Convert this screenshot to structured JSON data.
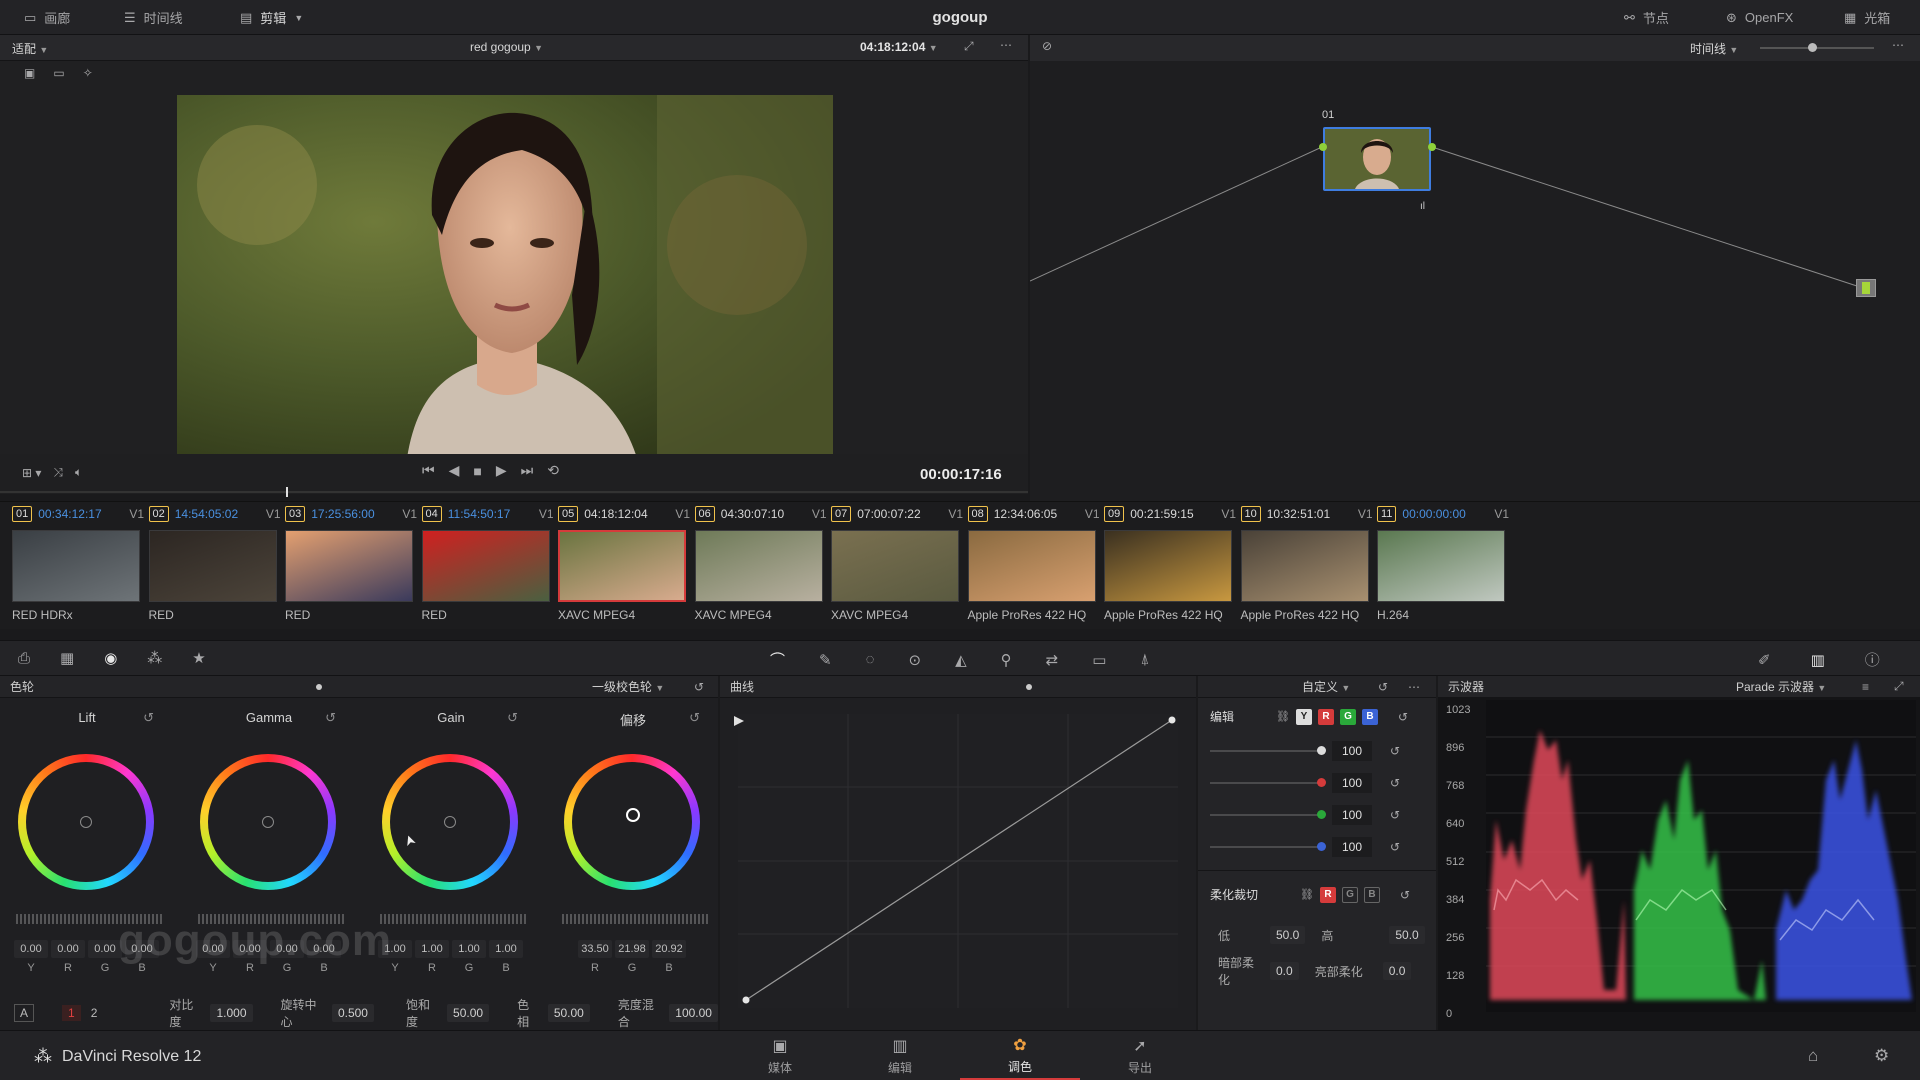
{
  "topbar": {
    "tabs": [
      {
        "label": "画廊"
      },
      {
        "label": "时间线"
      },
      {
        "label": "剪辑"
      }
    ],
    "title": "gogoup",
    "right": [
      {
        "label": "节点"
      },
      {
        "label": "OpenFX"
      },
      {
        "label": "光箱"
      }
    ]
  },
  "viewer": {
    "fit_label": "适配",
    "clip_name": "red gogoup",
    "timecode_top": "04:18:12:04",
    "timecode": "00:00:17:16"
  },
  "nodes": {
    "timeline_label": "时间线",
    "node_label": "01"
  },
  "clips": [
    {
      "num": "01",
      "tc": "00:34:12:17",
      "tc_blue": true,
      "track": "V1",
      "codec": "RED HDRx"
    },
    {
      "num": "02",
      "tc": "14:54:05:02",
      "tc_blue": true,
      "track": "V1",
      "codec": "RED"
    },
    {
      "num": "03",
      "tc": "17:25:56:00",
      "tc_blue": true,
      "track": "V1",
      "codec": "RED"
    },
    {
      "num": "04",
      "tc": "11:54:50:17",
      "tc_blue": true,
      "track": "V1",
      "codec": "RED"
    },
    {
      "num": "05",
      "tc": "04:18:12:04",
      "tc_blue": false,
      "track": "V1",
      "codec": "XAVC MPEG4"
    },
    {
      "num": "06",
      "tc": "04:30:07:10",
      "tc_blue": false,
      "track": "V1",
      "codec": "XAVC MPEG4"
    },
    {
      "num": "07",
      "tc": "07:00:07:22",
      "tc_blue": false,
      "track": "V1",
      "codec": "XAVC MPEG4"
    },
    {
      "num": "08",
      "tc": "12:34:06:05",
      "tc_blue": false,
      "track": "V1",
      "codec": "Apple ProRes 422 HQ"
    },
    {
      "num": "09",
      "tc": "00:21:59:15",
      "tc_blue": false,
      "track": "V1",
      "codec": "Apple ProRes 422 HQ"
    },
    {
      "num": "10",
      "tc": "10:32:51:01",
      "tc_blue": false,
      "track": "V1",
      "codec": "Apple ProRes 422 HQ"
    },
    {
      "num": "11",
      "tc": "00:00:00:00",
      "tc_blue": true,
      "track": "V1",
      "codec": "H.264"
    }
  ],
  "wheels": {
    "title": "色轮",
    "mode": "一级校色轮",
    "items": [
      {
        "name": "Lift",
        "vals": [
          "0.00",
          "0.00",
          "0.00",
          "0.00"
        ],
        "lbls": [
          "Y",
          "R",
          "G",
          "B"
        ]
      },
      {
        "name": "Gamma",
        "vals": [
          "0.00",
          "0.00",
          "0.00",
          "0.00"
        ],
        "lbls": [
          "Y",
          "R",
          "G",
          "B"
        ]
      },
      {
        "name": "Gain",
        "vals": [
          "1.00",
          "1.00",
          "1.00",
          "1.00"
        ],
        "lbls": [
          "Y",
          "R",
          "G",
          "B"
        ]
      },
      {
        "name": "偏移",
        "vals": [
          "33.50",
          "21.98",
          "20.92"
        ],
        "lbls": [
          "R",
          "G",
          "B"
        ]
      }
    ],
    "footer": {
      "page_a": "A",
      "page_1": "1",
      "page_2": "2",
      "contrast_label": "对比度",
      "contrast": "1.000",
      "pivot_label": "旋转中心",
      "pivot": "0.500",
      "sat_label": "饱和度",
      "sat": "50.00",
      "hue_label": "色相",
      "hue": "50.00",
      "lummix_label": "亮度混合",
      "lummix": "100.00"
    }
  },
  "curves": {
    "title": "曲线",
    "preset": "自定义"
  },
  "curve_edit": {
    "title": "编辑",
    "vals": [
      "100",
      "100",
      "100",
      "100"
    ],
    "soft_title": "柔化裁切",
    "low_label": "低",
    "low": "50.0",
    "high_label": "高",
    "high": "50.0",
    "dark_label": "暗部柔化",
    "dark": "0.0",
    "bright_label": "亮部柔化",
    "bright": "0.0"
  },
  "scope": {
    "title": "示波器",
    "mode": "Parade 示波器",
    "scale": [
      "1023",
      "896",
      "768",
      "640",
      "512",
      "384",
      "256",
      "128",
      "0"
    ]
  },
  "bottombar": {
    "app": "DaVinci Resolve 12",
    "pages": [
      {
        "label": "媒体"
      },
      {
        "label": "编辑"
      },
      {
        "label": "调色"
      },
      {
        "label": "导出"
      }
    ]
  },
  "watermark": "gogoup.com",
  "colors": {
    "accent": "#d53b3b",
    "clip_num_border": "#f0c24c",
    "tc_blue": "#4a90e0"
  }
}
